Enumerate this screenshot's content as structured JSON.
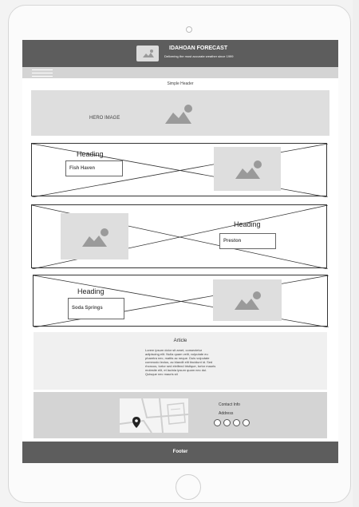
{
  "site": {
    "title": "IDAHOAN FORECAST",
    "tagline": "Delivering the most accurate weather since 1999"
  },
  "simple_header": "Simple Header",
  "hero": {
    "label": "HERO IMAGE"
  },
  "sections": [
    {
      "heading": "Heading",
      "name": "Fish Haven"
    },
    {
      "heading": "Heading",
      "name": "Preston"
    },
    {
      "heading": "Heading",
      "name": "Soda Springs"
    }
  ],
  "article": {
    "title": "Article",
    "body": "Lorem ipsum dolor sit amet, consectetur adipiscing elit. Nulla quam velit, vulputate eu pharetra nec, mattis ac neque. Duis vulputate commodo lectus, ac blandit elit tincidunt id. Sed rhoncus, tortor sed eleifend tristique, tortor mauris molestie elit, et lacinia ipsum quam nec dui. Quisque nec mauris sit"
  },
  "contact": {
    "title": "Contact Info",
    "address": "Address"
  },
  "footer": {
    "label": "Footer"
  },
  "icons": {
    "logo": "image-icon",
    "map_marker": "map-pin-icon",
    "placeholder": "image-icon",
    "menu": "hamburger-menu-icon"
  }
}
